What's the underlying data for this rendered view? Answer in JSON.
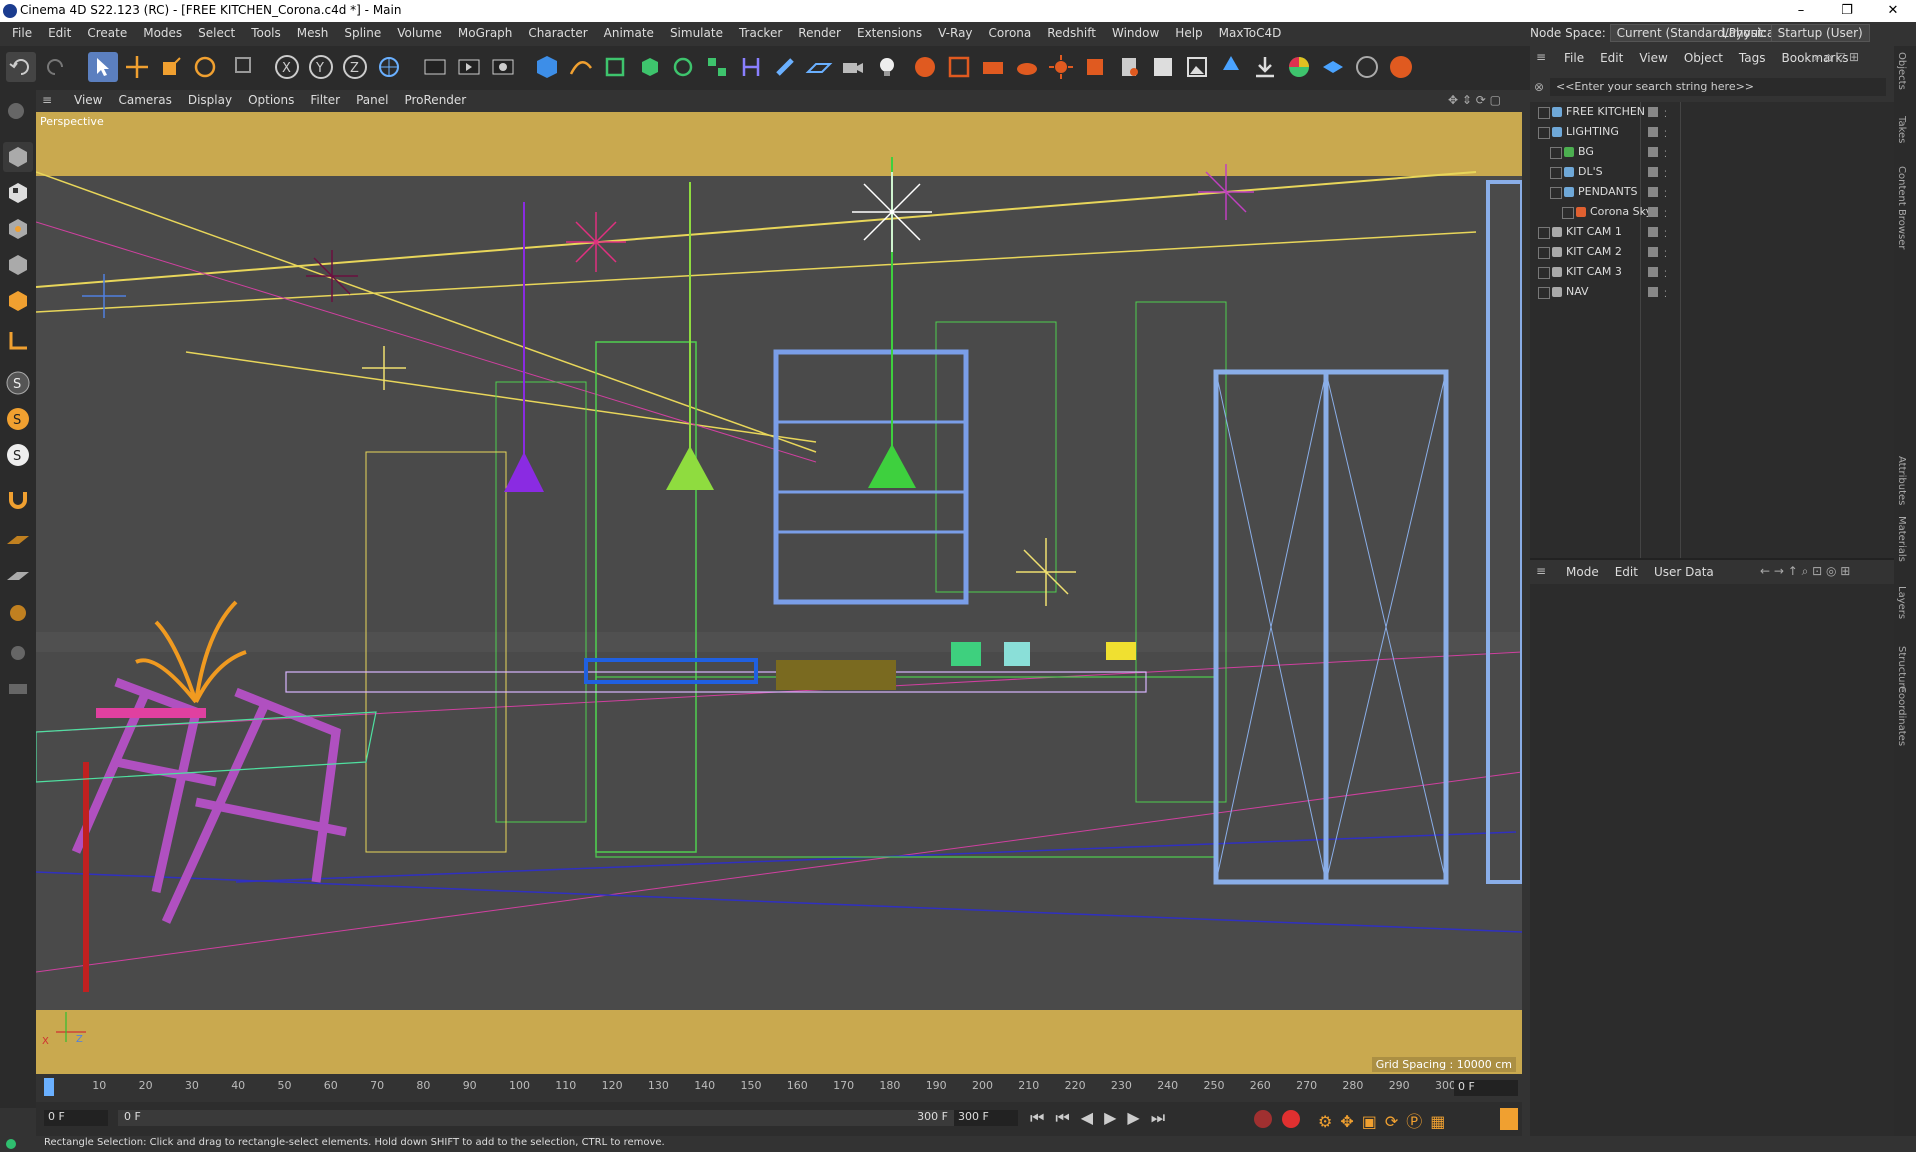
{
  "window": {
    "title": "Cinema 4D S22.123 (RC) - [FREE KITCHEN_Corona.c4d *] - Main",
    "controls": [
      "–",
      "❐",
      "✕"
    ]
  },
  "menubar": {
    "items": [
      "File",
      "Edit",
      "Create",
      "Modes",
      "Select",
      "Tools",
      "Mesh",
      "Spline",
      "Volume",
      "MoGraph",
      "Character",
      "Animate",
      "Simulate",
      "Tracker",
      "Render",
      "Extensions",
      "V-Ray",
      "Corona",
      "Redshift",
      "Window",
      "Help",
      "MaxToC4D"
    ],
    "node_space_label": "Node Space:",
    "node_space_value": "Current (Standard/Physical)",
    "layout_label": "Layout:",
    "layout_value": "Startup (User)"
  },
  "viewport": {
    "menu": [
      "View",
      "Cameras",
      "Display",
      "Options",
      "Filter",
      "Panel",
      "ProRender"
    ],
    "label": "Perspective",
    "grid_spacing": "Grid Spacing : 10000 cm",
    "axis_x": "X",
    "axis_z": "Z"
  },
  "objects": {
    "menu": [
      "File",
      "Edit",
      "View",
      "Object",
      "Tags",
      "Bookmarks"
    ],
    "search_placeholder": "<<Enter your search string here>>",
    "rows": [
      {
        "name": "FREE KITCHEN",
        "indent": 0,
        "color": "#6fa8d8"
      },
      {
        "name": "LIGHTING",
        "indent": 0,
        "color": "#6fa8d8"
      },
      {
        "name": "BG",
        "indent": 1,
        "color": "#4caf50"
      },
      {
        "name": "DL'S",
        "indent": 1,
        "color": "#6fa8d8"
      },
      {
        "name": "PENDANTS",
        "indent": 1,
        "color": "#6fa8d8"
      },
      {
        "name": "Corona Sky",
        "indent": 2,
        "color": "#e06030"
      },
      {
        "name": "KIT CAM 1",
        "indent": 0,
        "color": "#aaaaaa"
      },
      {
        "name": "KIT CAM 2",
        "indent": 0,
        "color": "#aaaaaa"
      },
      {
        "name": "KIT CAM 3",
        "indent": 0,
        "color": "#aaaaaa"
      },
      {
        "name": "NAV",
        "indent": 0,
        "color": "#aaaaaa"
      }
    ]
  },
  "attributes": {
    "menu": [
      "Mode",
      "Edit",
      "User Data"
    ]
  },
  "side_tabs": [
    "Objects",
    "Takes",
    "Content Browser",
    "Attributes",
    "Materials",
    "Layers",
    "Structure",
    "Coordinates"
  ],
  "timeline": {
    "ticks": [
      "0",
      "10",
      "20",
      "30",
      "40",
      "50",
      "60",
      "70",
      "80",
      "90",
      "100",
      "110",
      "120",
      "130",
      "140",
      "150",
      "160",
      "170",
      "180",
      "190",
      "200",
      "210",
      "220",
      "230",
      "240",
      "250",
      "260",
      "270",
      "280",
      "290",
      "300"
    ],
    "current_frame": "0 F"
  },
  "transport": {
    "start_frame": "0 F",
    "preview_start": "0 F",
    "preview_end": "300 F",
    "end_frame": "300 F"
  },
  "status": {
    "text": "Rectangle Selection: Click and drag to rectangle-select elements. Hold down SHIFT to add to the selection, CTRL to remove."
  },
  "colors": {
    "accent": "#c9a94f",
    "viewport_bg": "#4a4a4a"
  }
}
